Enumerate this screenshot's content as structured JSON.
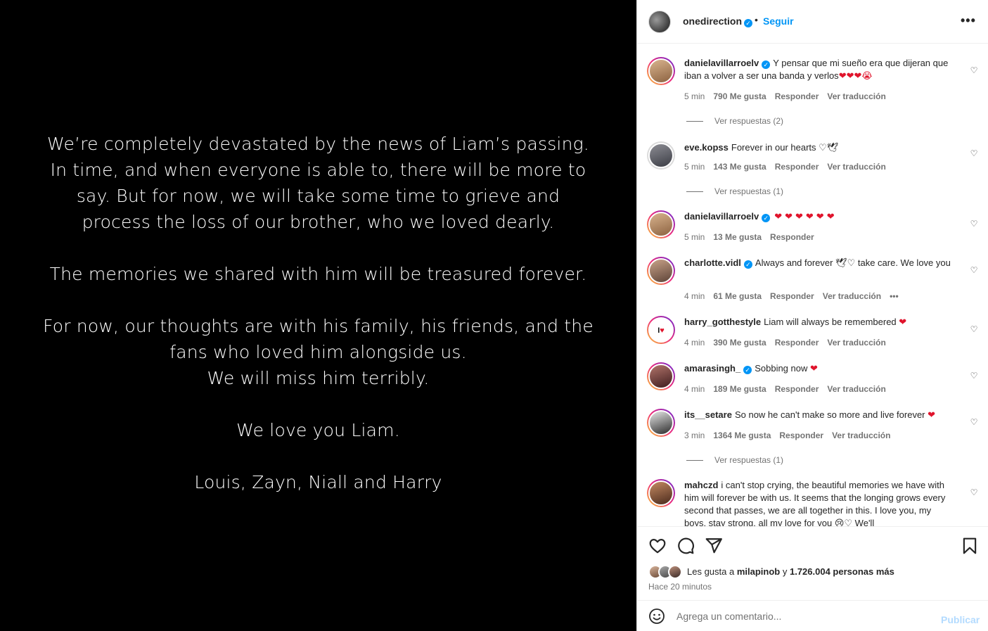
{
  "post": {
    "paragraphs": [
      [
        "We’re completely devastated by the news of Liam’s passing.",
        "In time, and when everyone is able to, there will be more to",
        "say. But for now, we will take some time to grieve and",
        "process the loss of our brother, who we loved dearly."
      ],
      [
        "The memories we shared with him will be treasured forever."
      ],
      [
        "For now, our thoughts are with his family, his friends, and the",
        "fans who loved him alongside us.",
        "We will miss him terribly."
      ],
      [
        "We love you Liam."
      ],
      [
        "Louis, Zayn, Niall and Harry"
      ]
    ]
  },
  "header": {
    "username": "onedirection",
    "dot": "•",
    "follow_label": "Seguir",
    "more": "•••"
  },
  "comments": [
    {
      "user": "danielavillarroelv",
      "verified": true,
      "text": "Y pensar que mi sueño era que dijeran que iban a volver a ser una banda y verlos",
      "emoji": "❤❤❤😭",
      "time": "5 min",
      "likes": "790 Me gusta",
      "reply": "Responder",
      "translate": "Ver traducción",
      "replies": "Ver respuestas (2)"
    },
    {
      "user": "eve.kopss",
      "verified": false,
      "text": "Forever in our hearts",
      "emoji": "♡🕊",
      "time": "5 min",
      "likes": "143 Me gusta",
      "reply": "Responder",
      "translate": "Ver traducción",
      "replies": "Ver respuestas (1)"
    },
    {
      "user": "danielavillarroelv",
      "verified": true,
      "text": "",
      "emoji": "❤❤❤❤❤❤",
      "time": "5 min",
      "likes": "13 Me gusta",
      "reply": "Responder",
      "translate": "",
      "replies": ""
    },
    {
      "user": "charlotte.vidl",
      "verified": true,
      "text": "Always and forever 🕊♡ take care. We love you",
      "emoji": "",
      "time": "4 min",
      "likes": "61 Me gusta",
      "reply": "Responder",
      "translate": "Ver traducción",
      "more": "•••",
      "replies": ""
    },
    {
      "user": "harry_gotthestyle",
      "verified": false,
      "text": "Liam will always be remembered",
      "emoji": "❤",
      "time": "4 min",
      "likes": "390 Me gusta",
      "reply": "Responder",
      "translate": "Ver traducción",
      "replies": ""
    },
    {
      "user": "amarasingh_",
      "verified": true,
      "text": "Sobbing now",
      "emoji": "❤",
      "time": "4 min",
      "likes": "189 Me gusta",
      "reply": "Responder",
      "translate": "Ver traducción",
      "replies": ""
    },
    {
      "user": "its__setare",
      "verified": false,
      "text": "So now he can't make so more and live forever",
      "emoji": "❤",
      "time": "3 min",
      "likes": "1364 Me gusta",
      "reply": "Responder",
      "translate": "Ver traducción",
      "replies": "Ver respuestas (1)"
    },
    {
      "user": "mahczd",
      "verified": false,
      "text": "i can't stop crying, the beautiful memories we have with him will forever be with us. It seems that the longing grows every second that passes, we are all together in this. I love you, my boys, stay strong, all my love for you 😢♡ We'll",
      "emoji": "",
      "time": "",
      "likes": "",
      "reply": "",
      "translate": "",
      "replies": ""
    }
  ],
  "likes": {
    "prefix": "Les gusta a",
    "user": "milapinob",
    "connector": "y",
    "count": "1.726.004 personas más"
  },
  "time_ago": "Hace 20 minutos",
  "add_comment": {
    "placeholder": "Agrega un comentario...",
    "publish_label": "Publicar"
  },
  "icons": {
    "like": "heart-icon",
    "comment": "comment-icon",
    "share": "share-icon",
    "save": "bookmark-icon",
    "emoji": "emoji-icon"
  },
  "colors": {
    "accent": "#0095f6",
    "heart": "#e0142c",
    "publish_disabled": "#b3dbff"
  }
}
